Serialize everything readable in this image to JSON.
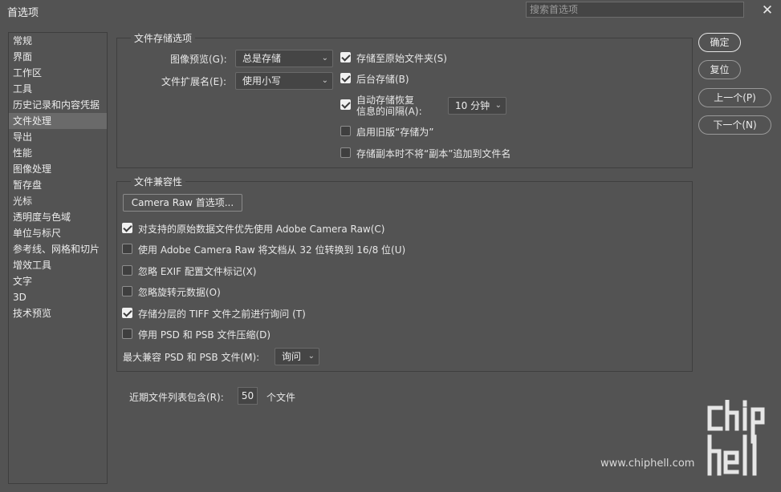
{
  "window": {
    "title": "首选项",
    "search_placeholder": "搜索首选项",
    "close_glyph": "✕"
  },
  "sidebar": {
    "items": [
      {
        "label": "常规"
      },
      {
        "label": "界面"
      },
      {
        "label": "工作区"
      },
      {
        "label": "工具"
      },
      {
        "label": "历史记录和内容凭据"
      },
      {
        "label": "文件处理",
        "selected": true
      },
      {
        "label": "导出"
      },
      {
        "label": "性能"
      },
      {
        "label": "图像处理"
      },
      {
        "label": "暂存盘"
      },
      {
        "label": "光标"
      },
      {
        "label": "透明度与色域"
      },
      {
        "label": "单位与标尺"
      },
      {
        "label": "参考线、网格和切片"
      },
      {
        "label": "增效工具"
      },
      {
        "label": "文字"
      },
      {
        "label": "3D"
      },
      {
        "label": "技术预览"
      }
    ]
  },
  "file_saving": {
    "title": "文件存储选项",
    "image_preview_label": "图像预览(G):",
    "image_preview_value": "总是存储",
    "extension_label": "文件扩展名(E):",
    "extension_value": "使用小写",
    "save_to_original_folder": {
      "label": "存储至原始文件夹(S)",
      "checked": true
    },
    "background_save": {
      "label": "后台存储(B)",
      "checked": true
    },
    "auto_recovery": {
      "label_line1": "自动存储恢复",
      "label_line2": "信息的间隔(A):",
      "checked": true,
      "interval_value": "10 分钟"
    },
    "legacy_save_as": {
      "label": "启用旧版“存储为”",
      "checked": false
    },
    "no_copy_suffix": {
      "label": "存储副本时不将“副本”追加到文件名",
      "checked": false
    }
  },
  "compatibility": {
    "title": "文件兼容性",
    "camera_raw_button": "Camera Raw 首选项...",
    "options": [
      {
        "label": "对支持的原始数据文件优先使用 Adobe Camera Raw(C)",
        "checked": true
      },
      {
        "label": "使用 Adobe Camera Raw 将文档从 32 位转换到 16/8 位(U)",
        "checked": false
      },
      {
        "label": "忽略 EXIF 配置文件标记(X)",
        "checked": false
      },
      {
        "label": "忽略旋转元数据(O)",
        "checked": false
      },
      {
        "label": "存储分层的 TIFF 文件之前进行询问 (T)",
        "checked": true
      },
      {
        "label": "停用 PSD 和 PSB 文件压缩(D)",
        "checked": false
      }
    ],
    "max_compat_label": "最大兼容 PSD 和 PSB 文件(M):",
    "max_compat_value": "询问"
  },
  "recent_files": {
    "label": "近期文件列表包含(R):",
    "value": "50",
    "suffix": "个文件"
  },
  "buttons": {
    "ok": "确定",
    "reset": "复位",
    "prev": "上一个(P)",
    "next": "下一个(N)"
  },
  "watermark": {
    "url": "www.chiphell.com"
  }
}
